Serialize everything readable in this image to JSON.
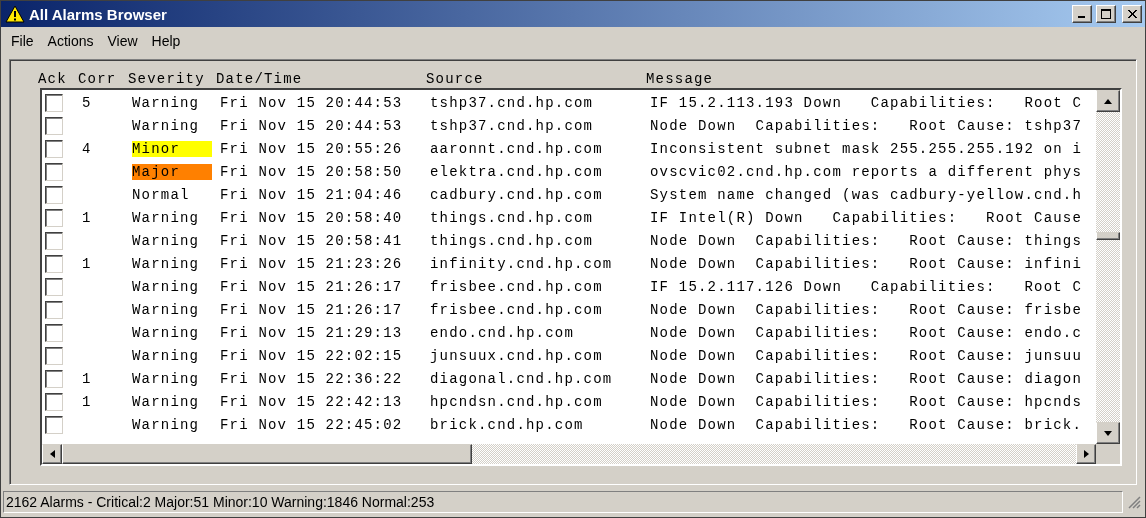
{
  "window": {
    "title": "All Alarms Browser"
  },
  "menu": [
    "File",
    "Actions",
    "View",
    "Help"
  ],
  "table": {
    "columns": [
      "Ack",
      "Corr",
      "Severity",
      "Date/Time",
      "Source",
      "Message"
    ],
    "rows": [
      {
        "ack": false,
        "corr": "5",
        "severity": "Warning",
        "datetime": "Fri Nov 15 20:44:53",
        "source": "tshp37.cnd.hp.com",
        "message": "IF 15.2.113.193 Down   Capabilities:   Root C"
      },
      {
        "ack": false,
        "severity": "Warning",
        "datetime": "Fri Nov 15 20:44:53",
        "source": "tshp37.cnd.hp.com",
        "message": "Node Down  Capabilities:   Root Cause: tshp37"
      },
      {
        "ack": false,
        "corr": "4",
        "severity": "Minor",
        "color": "#ffff00",
        "datetime": "Fri Nov 15 20:55:26",
        "source": "aaronnt.cnd.hp.com",
        "message": "Inconsistent subnet mask 255.255.255.192 on i"
      },
      {
        "ack": false,
        "severity": "Major",
        "color": "#ff8000",
        "datetime": "Fri Nov 15 20:58:50",
        "source": "elektra.cnd.hp.com",
        "message": "ovscvic02.cnd.hp.com reports a different phys"
      },
      {
        "ack": false,
        "severity": "Normal",
        "datetime": "Fri Nov 15 21:04:46",
        "source": "cadbury.cnd.hp.com",
        "message": "System name changed (was cadbury-yellow.cnd.h"
      },
      {
        "ack": false,
        "corr": "1",
        "severity": "Warning",
        "datetime": "Fri Nov 15 20:58:40",
        "source": "things.cnd.hp.com",
        "message": "IF Intel(R) Down   Capabilities:   Root Cause"
      },
      {
        "ack": false,
        "severity": "Warning",
        "datetime": "Fri Nov 15 20:58:41",
        "source": "things.cnd.hp.com",
        "message": "Node Down  Capabilities:   Root Cause: things"
      },
      {
        "ack": false,
        "corr": "1",
        "severity": "Warning",
        "datetime": "Fri Nov 15 21:23:26",
        "source": "infinity.cnd.hp.com",
        "message": "Node Down  Capabilities:   Root Cause: infini"
      },
      {
        "ack": false,
        "severity": "Warning",
        "datetime": "Fri Nov 15 21:26:17",
        "source": "frisbee.cnd.hp.com",
        "message": "IF 15.2.117.126 Down   Capabilities:   Root C"
      },
      {
        "ack": false,
        "severity": "Warning",
        "datetime": "Fri Nov 15 21:26:17",
        "source": "frisbee.cnd.hp.com",
        "message": "Node Down  Capabilities:   Root Cause: frisbe"
      },
      {
        "ack": false,
        "severity": "Warning",
        "datetime": "Fri Nov 15 21:29:13",
        "source": "endo.cnd.hp.com",
        "message": "Node Down  Capabilities:   Root Cause: endo.c"
      },
      {
        "ack": false,
        "severity": "Warning",
        "datetime": "Fri Nov 15 22:02:15",
        "source": "junsuux.cnd.hp.com",
        "message": "Node Down  Capabilities:   Root Cause: junsuu"
      },
      {
        "ack": false,
        "corr": "1",
        "severity": "Warning",
        "datetime": "Fri Nov 15 22:36:22",
        "source": "diagonal.cnd.hp.com",
        "message": "Node Down  Capabilities:   Root Cause: diagon"
      },
      {
        "ack": false,
        "corr": "1",
        "severity": "Warning",
        "datetime": "Fri Nov 15 22:42:13",
        "source": "hpcndsn.cnd.hp.com",
        "message": "Node Down  Capabilities:   Root Cause: hpcnds"
      },
      {
        "ack": false,
        "severity": "Warning",
        "datetime": "Fri Nov 15 22:45:02",
        "source": "brick.cnd.hp.com",
        "message": "Node Down  Capabilities:   Root Cause: brick."
      }
    ]
  },
  "status_bar": "2162 Alarms -  Critical:2  Major:51  Minor:10  Warning:1846  Normal:253"
}
